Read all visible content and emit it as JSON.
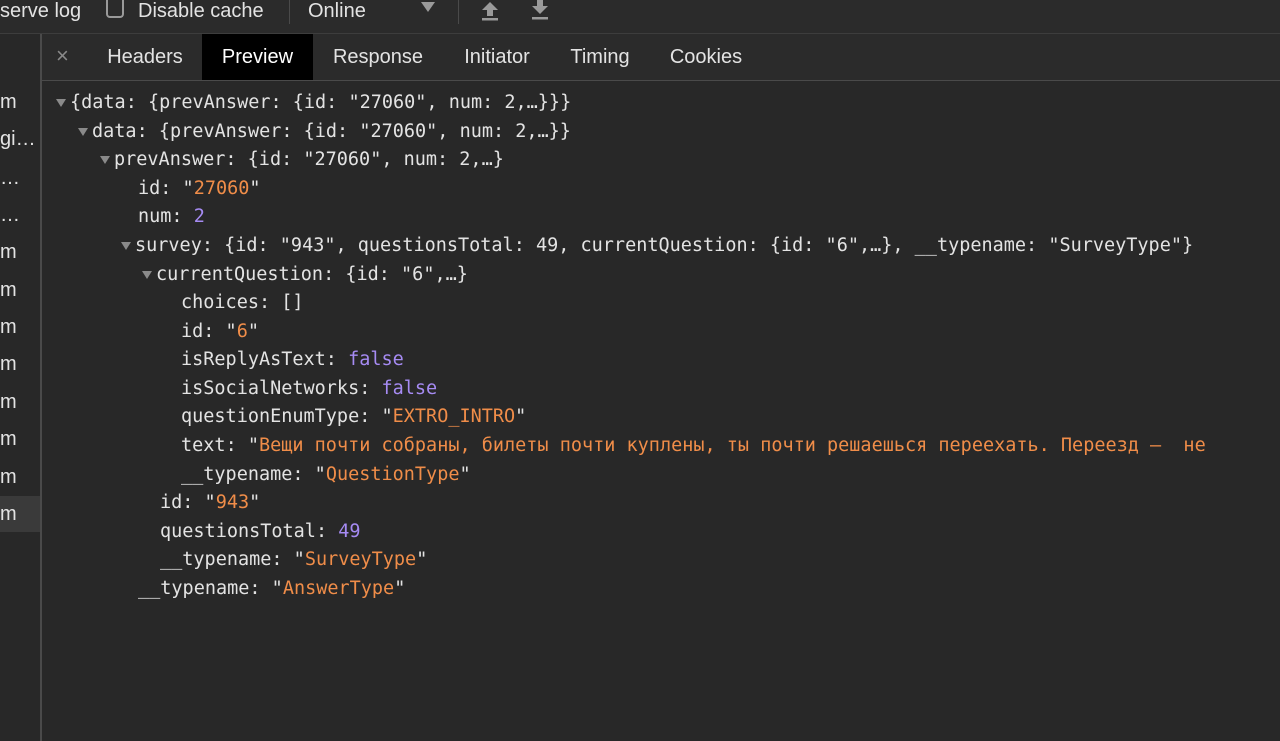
{
  "toolbar": {
    "preserve_log_label": "serve log",
    "disable_cache_label": "Disable cache",
    "throttling_value": "Online"
  },
  "left_list": {
    "rows": [
      "m",
      "gi…",
      "…",
      "…",
      "m",
      "m",
      "m",
      "m",
      "m",
      "m",
      "m",
      "m"
    ]
  },
  "tabs": {
    "close": "×",
    "items": [
      "Headers",
      "Preview",
      "Response",
      "Initiator",
      "Timing",
      "Cookies"
    ],
    "active": "Preview"
  },
  "preview": {
    "root_summary": "{data: {prevAnswer: {id: \"27060\", num: 2,…}}}",
    "data_key": "data",
    "data_summary": "{prevAnswer: {id: \"27060\", num: 2,…}}",
    "prev_key": "prevAnswer",
    "prev_summary": "{id: \"27060\", num: 2,…}",
    "id_key": "id",
    "id_val": "27060",
    "num_key": "num",
    "num_val": "2",
    "survey_key": "survey",
    "survey_summary": "{id: \"943\", questionsTotal: 49, currentQuestion: {id: \"6\",…}, __typename: \"SurveyType\"}",
    "cq_key": "currentQuestion",
    "cq_summary": "{id: \"6\",…}",
    "choices_key": "choices",
    "choices_val": "[]",
    "cq_id_key": "id",
    "cq_id_val": "6",
    "reply_key": "isReplyAsText",
    "reply_val": "false",
    "social_key": "isSocialNetworks",
    "social_val": "false",
    "qtype_key": "questionEnumType",
    "qtype_val": "EXTRO_INTRO",
    "text_key": "text",
    "text_val": "Вещи почти собраны, билеты почти куплены, ты почти решаешься переехать. Переезд —  не",
    "cq_typename_key": "__typename",
    "cq_typename_val": "QuestionType",
    "s_id_key": "id",
    "s_id_val": "943",
    "qt_key": "questionsTotal",
    "qt_val": "49",
    "s_typename_key": "__typename",
    "s_typename_val": "SurveyType",
    "a_typename_key": "__typename",
    "a_typename_val": "AnswerType"
  }
}
